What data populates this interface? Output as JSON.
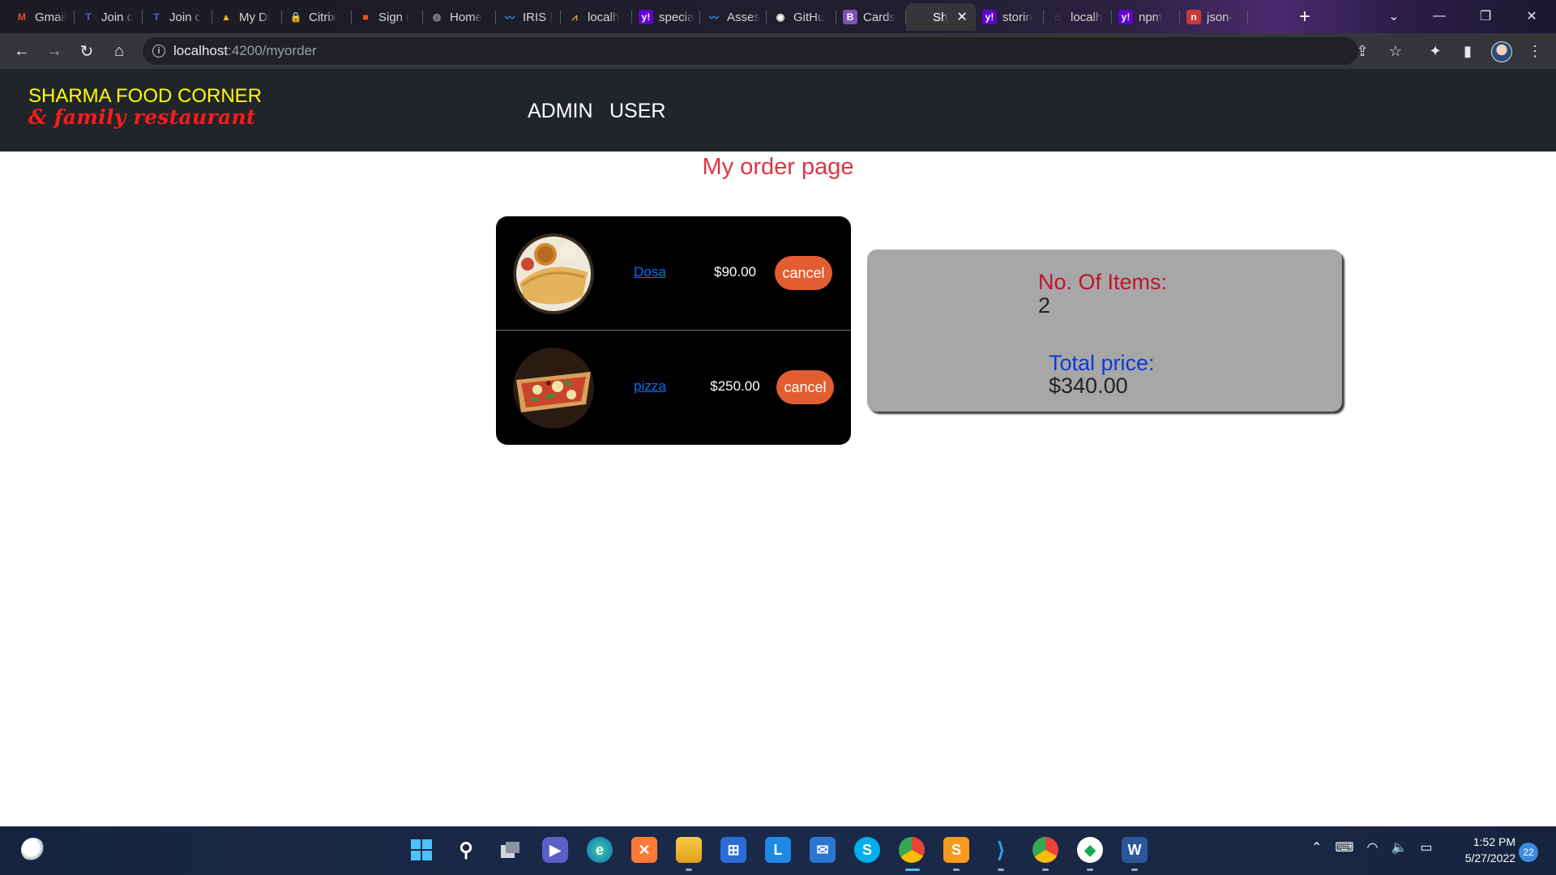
{
  "browser": {
    "tabs": [
      {
        "label": "Gmail",
        "icon": "gmail-icon",
        "color": "#ea4335",
        "glyph": "M"
      },
      {
        "label": "Join c",
        "icon": "teams-icon",
        "color": "#5b5fc7",
        "glyph": "T"
      },
      {
        "label": "Join c",
        "icon": "teams-icon",
        "color": "#5b5fc7",
        "glyph": "T"
      },
      {
        "label": "My Di",
        "icon": "drive-icon",
        "color": "#fbbc04",
        "glyph": "▲"
      },
      {
        "label": "Citrix",
        "icon": "citrix-icon",
        "color": "#3f8ddb",
        "glyph": "🔒"
      },
      {
        "label": "Sign i",
        "icon": "microsoft-icon",
        "color": "#f25022",
        "glyph": "■"
      },
      {
        "label": "Home",
        "icon": "globe-icon",
        "color": "#8a8a8a",
        "glyph": "◍"
      },
      {
        "label": "IRIS |",
        "icon": "iris-icon",
        "color": "#4a8fe0",
        "glyph": "〰"
      },
      {
        "label": "localh",
        "icon": "localhost-icon",
        "color": "#d9a441",
        "glyph": "⩘"
      },
      {
        "label": "specia",
        "icon": "yahoo-icon",
        "color": "#6001d2",
        "glyph": "y!"
      },
      {
        "label": "Asses",
        "icon": "assessment-icon",
        "color": "#4a8fe0",
        "glyph": "〰"
      },
      {
        "label": "GitHu",
        "icon": "github-icon",
        "color": "#ffffff",
        "glyph": "◉"
      },
      {
        "label": "Cards",
        "icon": "bootstrap-icon",
        "color": "#7952b3",
        "glyph": "B"
      },
      {
        "label": "Sh",
        "icon": "angular-icon",
        "color": "#35363a",
        "glyph": "A",
        "active": true
      },
      {
        "label": "storin",
        "icon": "yahoo-icon",
        "color": "#6001d2",
        "glyph": "y!"
      },
      {
        "label": "localh",
        "icon": "localhost-icon",
        "color": "#555555",
        "glyph": "⌂"
      },
      {
        "label": "npm",
        "icon": "yahoo-icon",
        "color": "#6001d2",
        "glyph": "y!"
      },
      {
        "label": "json-",
        "icon": "npm-icon",
        "color": "#cb3837",
        "glyph": "n"
      }
    ],
    "url_host": "localhost",
    "url_path": ":4200/myorder"
  },
  "header": {
    "brand_name": "SHARMA FOOD CORNER",
    "brand_sub": "& family restaurant",
    "nav": [
      "ADMIN",
      "USER"
    ]
  },
  "page": {
    "title": "My order page",
    "orders": [
      {
        "name": "Dosa",
        "price": "$90.00",
        "action": "cancel"
      },
      {
        "name": "pizza",
        "price": "$250.00",
        "action": "cancel"
      }
    ],
    "summary": {
      "items_label": "No. Of Items:",
      "items_value": "2",
      "price_label": "Total price:",
      "price_value": "$340.00"
    }
  },
  "taskbar": {
    "time": "1:52 PM",
    "date": "5/27/2022",
    "notifications": "22"
  },
  "colors": {
    "header_bg": "#212529",
    "brand_yellow": "#ffff00",
    "brand_red": "#ff1a1a",
    "title_red": "#dc3545",
    "cancel_orange": "#e35d32",
    "summary_bg": "#a7a7a7"
  }
}
